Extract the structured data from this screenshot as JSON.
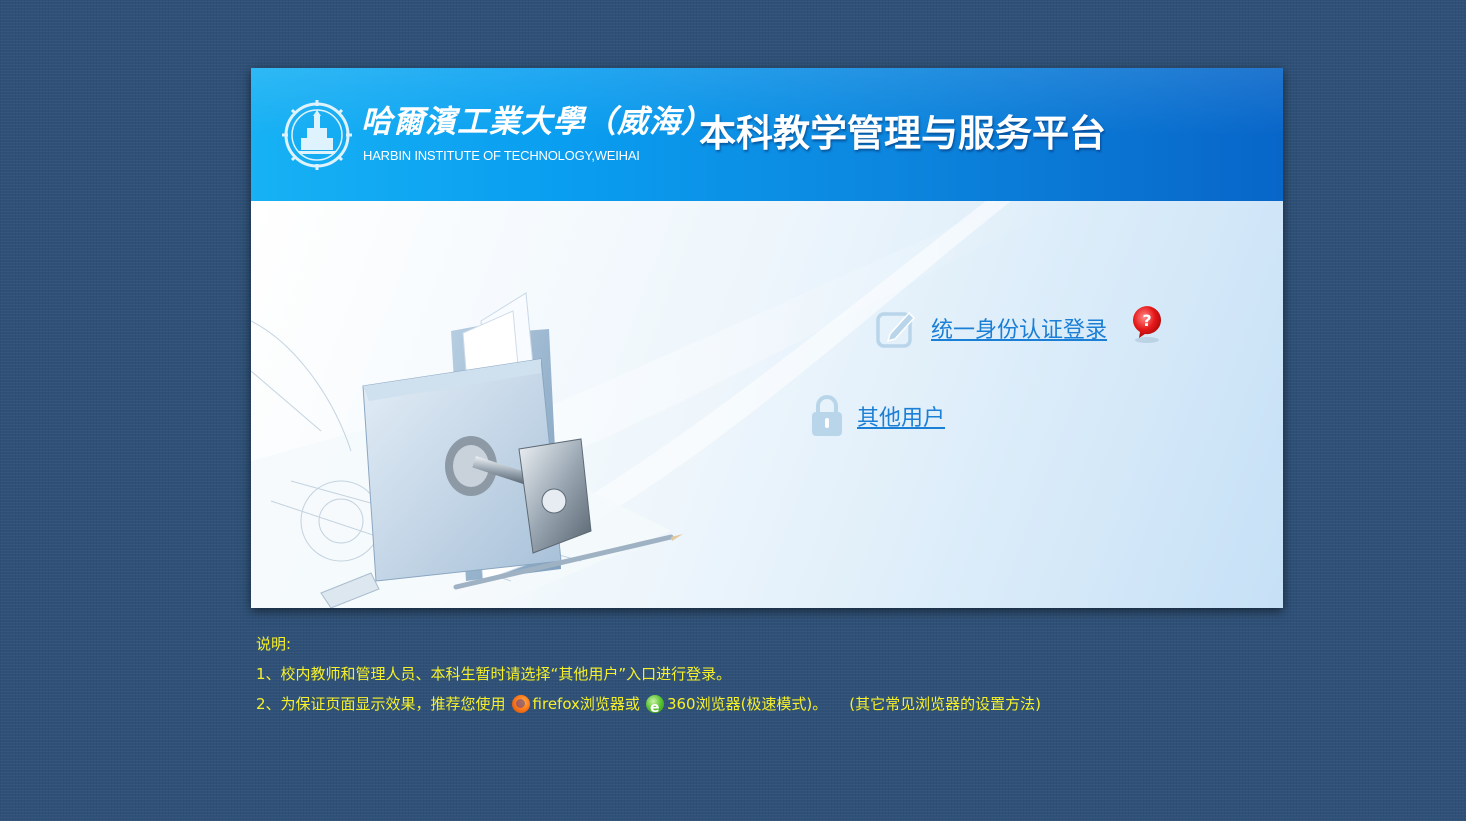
{
  "header": {
    "school_cn": "哈爾濱工業大學（威海）",
    "school_en": "HARBIN INSTITUTE OF TECHNOLOGY,WEIHAI",
    "platform_title": "本科教学管理与服务平台"
  },
  "login": {
    "sso_label": "统一身份认证登录",
    "other_label": "其他用户",
    "help_icon": "question-bubble-icon",
    "sso_icon": "edit-icon",
    "other_icon": "lock-icon"
  },
  "notes": {
    "heading": "说明:",
    "line1": "1、校内教师和管理人员、本科生暂时请选择“其他用户”入口进行登录。",
    "line2_prefix": "2、为保证页面显示效果，推荐您使用",
    "firefox_label": "firefox浏览器或",
    "browser360_label": "360浏览器(极速模式)。",
    "settings_link": "(其它常见浏览器的设置方法)"
  },
  "colors": {
    "page_background": "#2f5178",
    "banner_start": "#17b1f4",
    "banner_end": "#0866c9",
    "link": "#1b7fd6",
    "notes_text": "#f6f128"
  }
}
